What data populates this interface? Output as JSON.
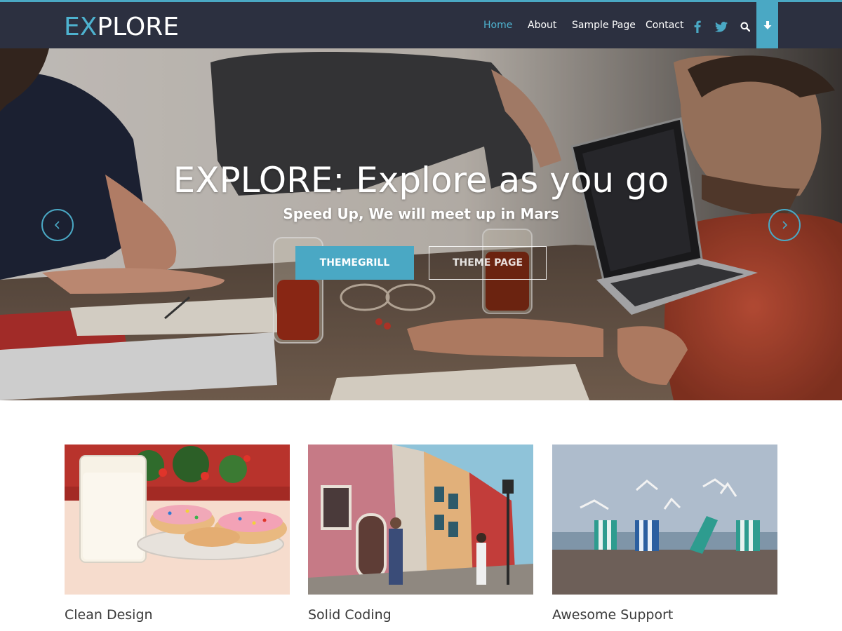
{
  "header": {
    "logo_prefix": "EX",
    "logo_rest": "PLORE",
    "nav": [
      {
        "label": "Home",
        "active": true
      },
      {
        "label": "About"
      },
      {
        "label": "Sample Page"
      },
      {
        "label": "Contact"
      }
    ],
    "icons": [
      "facebook-icon",
      "twitter-icon",
      "search-icon",
      "arrow-down-icon"
    ]
  },
  "hero": {
    "title": "EXPLORE: Explore as you go",
    "subtitle": "Speed Up, We will meet up in Mars",
    "primary_button": "THEMEGRILL",
    "secondary_button": "THEME PAGE"
  },
  "features": [
    {
      "title": "Clean Design"
    },
    {
      "title": "Solid Coding"
    },
    {
      "title": "Awesome Support"
    }
  ],
  "colors": {
    "accent": "#4aa8c4",
    "header_bg": "#2c3040",
    "text_dark": "#3a3a3a"
  }
}
